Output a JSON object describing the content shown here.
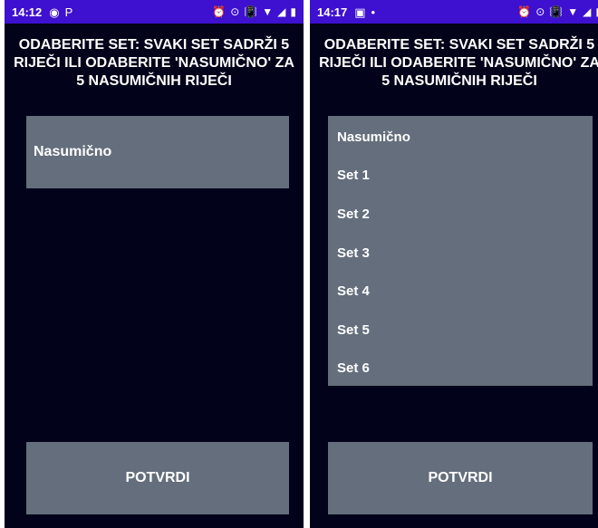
{
  "left_screen": {
    "status": {
      "time": "14:12",
      "left_icons": [
        "◉",
        "P"
      ],
      "right_icons": [
        "⏰",
        "⊙",
        "📳",
        "▼",
        "◢",
        "▮"
      ]
    },
    "prompt": "ODABERITE SET: SVAKI SET SADRŽI 5 RIJEČI ILI ODABERITE 'NASUMIČNO' ZA 5 NASUMIČNIH RIJEČI",
    "selected": "Nasumično",
    "confirm_label": "POTVRDI"
  },
  "right_screen": {
    "status": {
      "time": "14:17",
      "left_icons": [
        "▣",
        "•"
      ],
      "right_icons": [
        "⏰",
        "⊙",
        "📳",
        "▼",
        "◢",
        "▮"
      ]
    },
    "prompt": "ODABERITE SET: SVAKI SET SADRŽI 5 RIJEČI ILI ODABERITE 'NASUMIČNO' ZA 5 NASUMIČNIH RIJEČI",
    "options": [
      "Nasumično",
      "Set 1",
      "Set 2",
      "Set 3",
      "Set 4",
      "Set 5",
      "Set 6"
    ],
    "confirm_label": "POTVRDI"
  },
  "colors": {
    "background": "#02021a",
    "status_bar": "#3e10cf",
    "control": "#646e7c",
    "text": "#ffffff"
  }
}
